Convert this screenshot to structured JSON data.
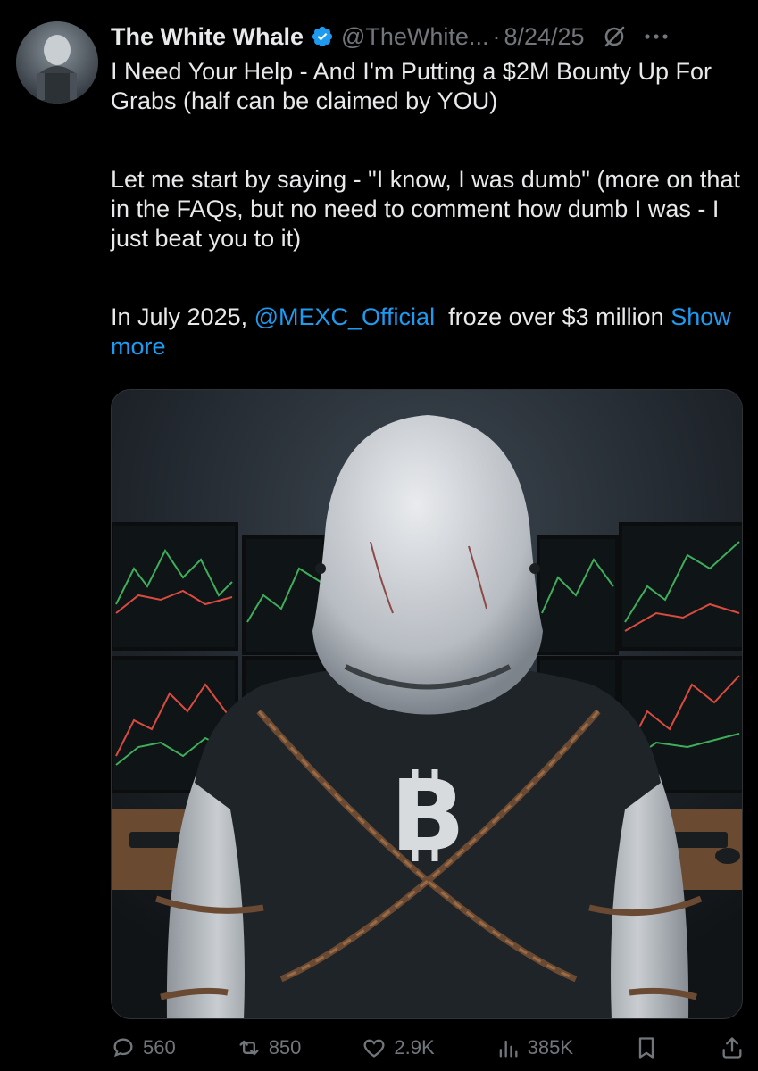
{
  "author": {
    "display_name": "The White Whale",
    "handle": "@TheWhite...",
    "separator": "·",
    "date": "8/24/25"
  },
  "post": {
    "para1": "I Need Your Help - And I'm Putting a $2M Bounty Up For Grabs (half can be claimed by YOU)",
    "para2": "Let me start by saying - \"I know, I was dumb\" (more on that in the FAQs, but no need to comment how dumb I was - I just beat you to it)",
    "para3_prefix": "In July 2025, ",
    "para3_mention": "@MEXC_Official",
    "para3_suffix": "  froze over $3 million ",
    "show_more": "Show more"
  },
  "media": {
    "icon": "whale-in-chains-bitcoin-image"
  },
  "actions": {
    "replies": "560",
    "reposts": "850",
    "likes": "2.9K",
    "views": "385K"
  },
  "colors": {
    "background": "#000000",
    "text": "#e7e9ea",
    "muted": "#71767b",
    "link": "#1d9bf0",
    "verified": "#1d9bf0"
  }
}
